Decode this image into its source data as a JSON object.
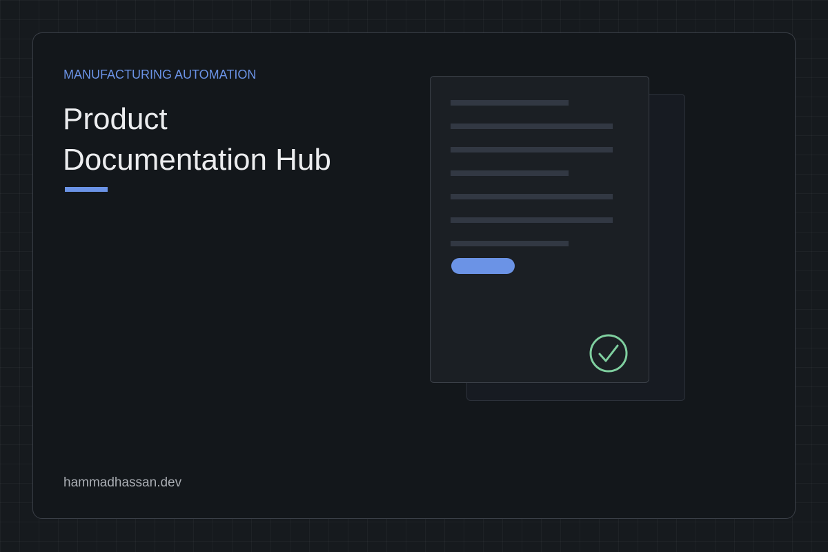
{
  "hero": {
    "eyebrow": "MANUFACTURING AUTOMATION",
    "title_line1": "Product",
    "title_line2": "Documentation Hub",
    "footer": "hammadhassan.dev"
  },
  "colors": {
    "accent": "#6b93e6",
    "check": "#7fcf9f",
    "background": "#161a1e"
  },
  "illustration": {
    "icon": "check-circle-icon"
  }
}
